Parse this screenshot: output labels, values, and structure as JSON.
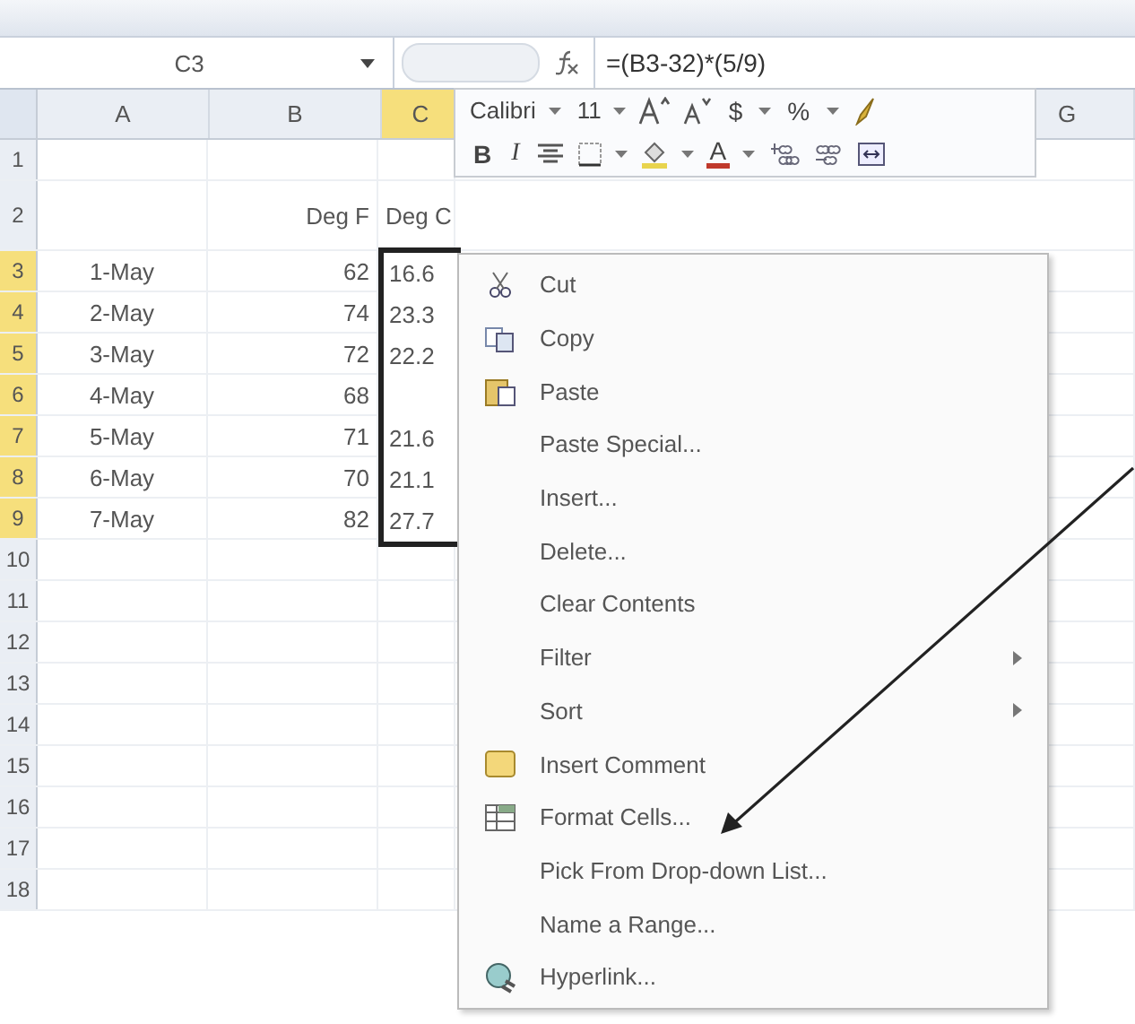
{
  "formula_bar": {
    "name_box": "C3",
    "formula": "=(B3-32)*(5/9)"
  },
  "columns": [
    {
      "label": "A",
      "selected": false
    },
    {
      "label": "B",
      "selected": false
    },
    {
      "label": "C",
      "selected": true
    },
    {
      "label": "G",
      "selected": false
    }
  ],
  "rows": [
    {
      "number": "1",
      "selected": false,
      "cells": [
        "",
        "",
        ""
      ]
    },
    {
      "number": "2",
      "selected": false,
      "cells": [
        "",
        "Deg F",
        "Deg C"
      ]
    },
    {
      "number": "3",
      "selected": true,
      "cells": [
        "1-May",
        "62",
        "16.6"
      ]
    },
    {
      "number": "4",
      "selected": true,
      "cells": [
        "2-May",
        "74",
        "23.3"
      ]
    },
    {
      "number": "5",
      "selected": true,
      "cells": [
        "3-May",
        "72",
        "22.2"
      ]
    },
    {
      "number": "6",
      "selected": true,
      "cells": [
        "4-May",
        "68",
        ""
      ]
    },
    {
      "number": "7",
      "selected": true,
      "cells": [
        "5-May",
        "71",
        "21.6"
      ]
    },
    {
      "number": "8",
      "selected": true,
      "cells": [
        "6-May",
        "70",
        "21.1"
      ]
    },
    {
      "number": "9",
      "selected": true,
      "cells": [
        "7-May",
        "82",
        "27.7"
      ]
    },
    {
      "number": "10",
      "selected": false,
      "cells": [
        "",
        "",
        ""
      ]
    },
    {
      "number": "11",
      "selected": false,
      "cells": [
        "",
        "",
        ""
      ]
    },
    {
      "number": "12",
      "selected": false,
      "cells": [
        "",
        "",
        ""
      ]
    },
    {
      "number": "13",
      "selected": false,
      "cells": [
        "",
        "",
        ""
      ]
    },
    {
      "number": "14",
      "selected": false,
      "cells": [
        "",
        "",
        ""
      ]
    },
    {
      "number": "15",
      "selected": false,
      "cells": [
        "",
        "",
        ""
      ]
    },
    {
      "number": "16",
      "selected": false,
      "cells": [
        "",
        "",
        ""
      ]
    },
    {
      "number": "17",
      "selected": false,
      "cells": [
        "",
        "",
        ""
      ]
    },
    {
      "number": "18",
      "selected": false,
      "cells": [
        "",
        "",
        ""
      ]
    }
  ],
  "mini_toolbar": {
    "font": "Calibri",
    "size": "11",
    "bold": "B",
    "italic": "I",
    "font_color": "A",
    "currency": "$",
    "percent": "%"
  },
  "context_menu": [
    {
      "label": "Cut",
      "kind": "cut",
      "submenu": false
    },
    {
      "label": "Copy",
      "kind": "copy",
      "submenu": false
    },
    {
      "label": "Paste",
      "kind": "paste",
      "submenu": false
    },
    {
      "label": "Paste Special...",
      "kind": "plain",
      "submenu": false
    },
    {
      "label": "Insert...",
      "kind": "plain",
      "submenu": false
    },
    {
      "label": "Delete...",
      "kind": "plain",
      "submenu": false
    },
    {
      "label": "Clear Contents",
      "kind": "plain",
      "submenu": false
    },
    {
      "label": "Filter",
      "kind": "plain",
      "submenu": true
    },
    {
      "label": "Sort",
      "kind": "plain",
      "submenu": true
    },
    {
      "label": "Insert Comment",
      "kind": "comment",
      "submenu": false
    },
    {
      "label": "Format Cells...",
      "kind": "format",
      "submenu": false
    },
    {
      "label": "Pick From Drop-down List...",
      "kind": "plain",
      "submenu": false
    },
    {
      "label": "Name a Range...",
      "kind": "plain",
      "submenu": false
    },
    {
      "label": "Hyperlink...",
      "kind": "link",
      "submenu": false
    }
  ]
}
